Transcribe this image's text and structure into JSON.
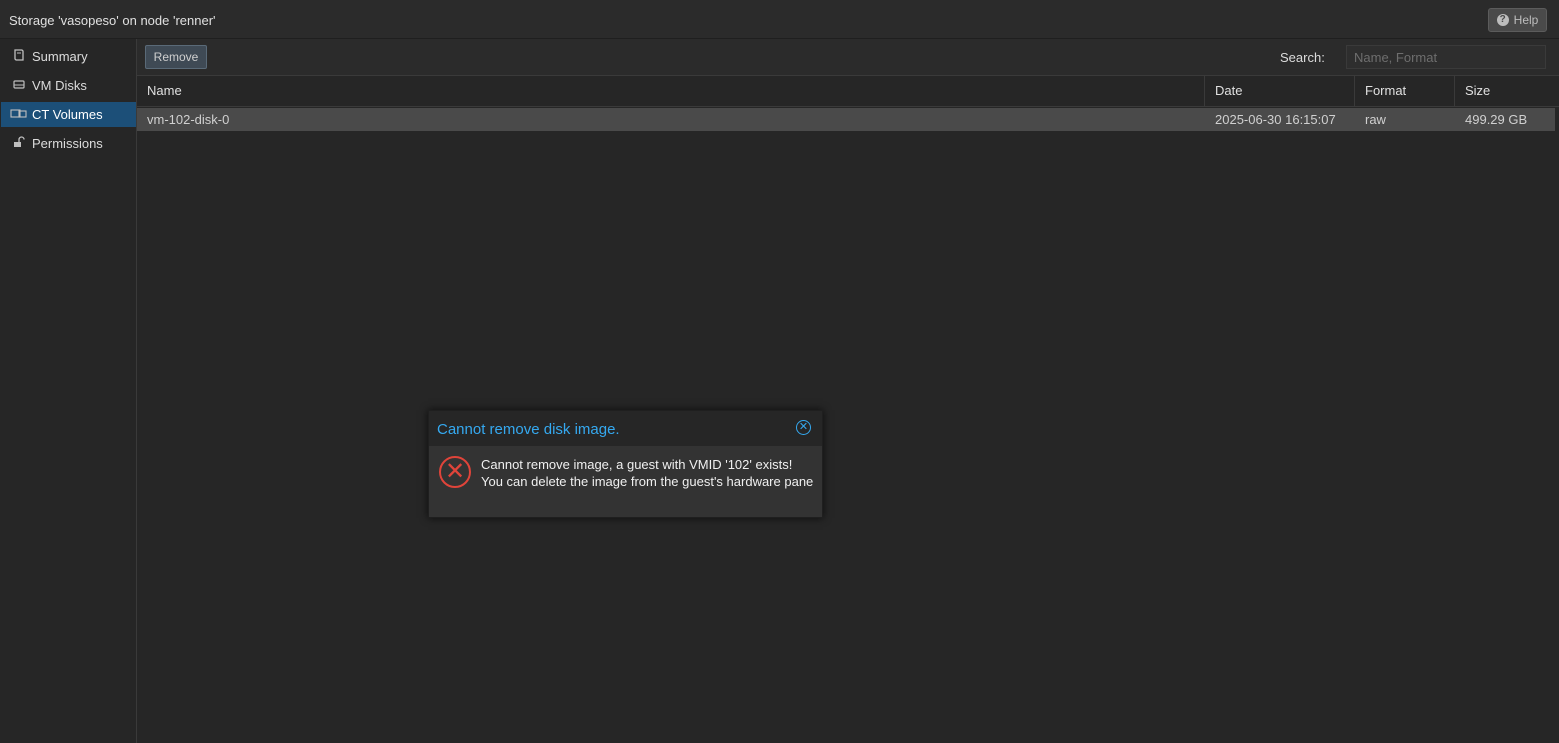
{
  "window": {
    "title": "Storage 'vasopeso' on node 'renner'",
    "help_label": "Help"
  },
  "sidebar": {
    "items": [
      {
        "label": "Summary",
        "icon": "book-icon"
      },
      {
        "label": "VM Disks",
        "icon": "hdd-icon"
      },
      {
        "label": "CT Volumes",
        "icon": "ct-volumes-icon",
        "active": true
      },
      {
        "label": "Permissions",
        "icon": "unlock-icon"
      }
    ]
  },
  "toolbar": {
    "remove_label": "Remove",
    "search_label": "Search:",
    "search_placeholder": "Name, Format",
    "search_value": ""
  },
  "table": {
    "columns": [
      "Name",
      "Date",
      "Format",
      "Size"
    ],
    "rows": [
      {
        "name": "vm-102-disk-0",
        "date": "2025-06-30 16:15:07",
        "format": "raw",
        "size": "499.29 GB"
      }
    ]
  },
  "dialog": {
    "title": "Cannot remove disk image.",
    "message_line1": "Cannot remove image, a guest with VMID '102' exists!",
    "message_line2": "You can delete the image from the guest's hardware pane"
  },
  "colors": {
    "accent": "#35a9f0",
    "selection": "#1c4f78",
    "error": "#e0443a"
  }
}
